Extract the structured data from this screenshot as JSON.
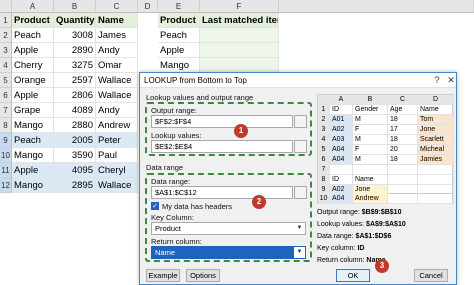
{
  "sheet": {
    "col_headers": [
      "A",
      "B",
      "C",
      "D",
      "E",
      "F"
    ],
    "row_headers": [
      "1",
      "2",
      "3",
      "4",
      "5",
      "6",
      "7",
      "8",
      "9",
      "10",
      "11",
      "12"
    ],
    "table1": {
      "headers": [
        "Product",
        "Quantity",
        "Name"
      ],
      "rows": [
        [
          "Peach",
          "3008",
          "James"
        ],
        [
          "Apple",
          "2890",
          "Andy"
        ],
        [
          "Cherry",
          "3275",
          "Omar"
        ],
        [
          "Orange",
          "2597",
          "Wallace"
        ],
        [
          "Apple",
          "2806",
          "Wallace"
        ],
        [
          "Grape",
          "4089",
          "Andy"
        ],
        [
          "Mango",
          "2880",
          "Andrew"
        ],
        [
          "Peach",
          "2005",
          "Peter"
        ],
        [
          "Mango",
          "3590",
          "Paul"
        ],
        [
          "Apple",
          "4095",
          "Cheryl"
        ],
        [
          "Mango",
          "2895",
          "Wallace"
        ]
      ]
    },
    "table2": {
      "headers": [
        "Product",
        "Last matched item"
      ],
      "rows": [
        [
          "Peach",
          ""
        ],
        [
          "Apple",
          ""
        ],
        [
          "Mango",
          ""
        ]
      ]
    }
  },
  "dialog": {
    "title": "LOOKUP from Bottom to Top",
    "help_label": "?",
    "close_label": "✕",
    "section1_label": "Lookup values and output range",
    "output_range_label": "Output range:",
    "output_range_value": "$F$2:$F$4",
    "lookup_values_label": "Lookup values:",
    "lookup_values_value": "$E$2:$E$4",
    "section2_label": "Data range",
    "data_range_label": "Data range:",
    "data_range_value": "$A$1:$C$12",
    "headers_checkbox_label": "My data has headers",
    "key_column_label": "Key Column:",
    "key_column_value": "Product",
    "return_column_label": "Return column:",
    "return_column_value": "Name",
    "badge1": "1",
    "badge2": "2",
    "badge3": "3",
    "example_button": "Example",
    "options_button": "Options",
    "ok_button": "OK",
    "cancel_button": "Cancel",
    "preview": {
      "col_headers": [
        "",
        "A",
        "B",
        "C",
        "D"
      ],
      "rows": [
        [
          "1",
          "ID",
          "Gender",
          "Age",
          "Name"
        ],
        [
          "2",
          "A01",
          "M",
          "18",
          "Tom"
        ],
        [
          "3",
          "A02",
          "F",
          "17",
          "Jone"
        ],
        [
          "4",
          "A03",
          "M",
          "18",
          "Scarlett"
        ],
        [
          "5",
          "A04",
          "F",
          "20",
          "Micheal"
        ],
        [
          "6",
          "A04",
          "M",
          "18",
          "Jamies"
        ],
        [
          "7",
          "",
          "",
          "",
          ""
        ],
        [
          "8",
          "ID",
          "Name",
          "",
          ""
        ],
        [
          "9",
          "A02",
          "Jone",
          "",
          ""
        ],
        [
          "10",
          "A04",
          "Andrew",
          "",
          ""
        ]
      ]
    },
    "info": {
      "output_label": "Output range:",
      "output_value": "$B$9:$B$10",
      "lookup_label": "Lookup values:",
      "lookup_value": "$A$9:$A$10",
      "data_label": "Data range:",
      "data_value": "$A$1:$D$6",
      "key_label": "Key column:",
      "key_value": "ID",
      "return_label": "Return column:",
      "return_value": "Name"
    }
  }
}
